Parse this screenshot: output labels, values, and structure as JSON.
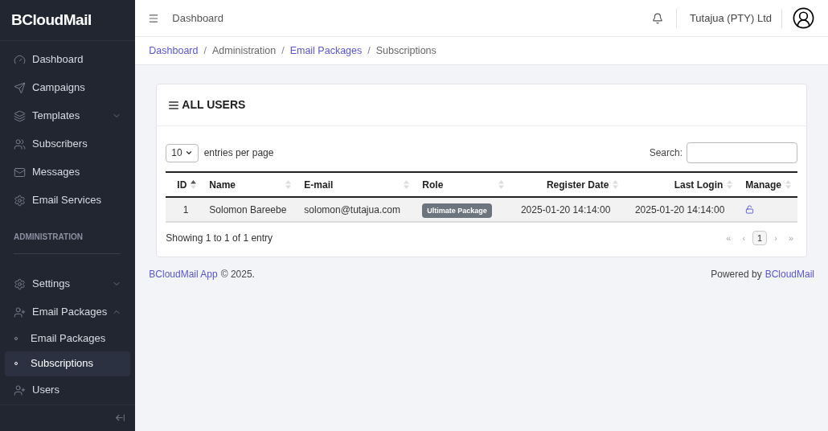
{
  "sidebar": {
    "logo": "BCloudMail",
    "items": [
      {
        "label": "Dashboard"
      },
      {
        "label": "Campaigns"
      },
      {
        "label": "Templates",
        "expanded": false
      },
      {
        "label": "Subscribers"
      },
      {
        "label": "Messages"
      },
      {
        "label": "Email Services"
      }
    ],
    "section_label": "ADMINISTRATION",
    "admin_items": [
      {
        "label": "Settings",
        "expanded": false
      },
      {
        "label": "Email Packages",
        "expanded": true,
        "children": [
          {
            "label": "Email Packages",
            "selected": false
          },
          {
            "label": "Subscriptions",
            "selected": true
          }
        ]
      },
      {
        "label": "Users"
      }
    ]
  },
  "header": {
    "title": "Dashboard",
    "company": "Tutajua (PTY) Ltd"
  },
  "breadcrumb": [
    {
      "label": "Dashboard",
      "link": true
    },
    {
      "label": "Administration",
      "link": false,
      "separator": "/"
    },
    {
      "label": "Email Packages",
      "link": true,
      "separator": "/"
    },
    {
      "label": "Subscriptions",
      "link": false,
      "separator": "/"
    }
  ],
  "card": {
    "title": "ALL USERS",
    "page_size": "10",
    "page_size_label": "entries per page",
    "search_label": "Search:",
    "columns": [
      {
        "label": "ID",
        "sorted": true
      },
      {
        "label": "Name",
        "sorted": false
      },
      {
        "label": "E-mail",
        "sorted": false
      },
      {
        "label": "Role",
        "sorted": false
      },
      {
        "label": "Register Date",
        "sorted": false
      },
      {
        "label": "Last Login",
        "sorted": false
      },
      {
        "label": "Manage",
        "sorted": false
      }
    ],
    "rows": [
      {
        "id": "1",
        "name": "Solomon Bareebe",
        "email": "solomon@tutajua.com",
        "role": "Ultimate Package",
        "register_date": "2025-01-20 14:14:00",
        "last_login": "2025-01-20 14:14:00"
      }
    ],
    "info": "Showing 1 to 1 of 1 entry",
    "pagination": [
      {
        "label": "«",
        "selected": false
      },
      {
        "label": "‹",
        "selected": false
      },
      {
        "label": "1",
        "selected": true
      },
      {
        "label": "›",
        "selected": false
      },
      {
        "label": "»",
        "selected": false
      }
    ]
  },
  "footer": {
    "app": "BCloudMail App",
    "copyright": "© 2025.",
    "powered": "Powered by",
    "brand": "BCloudMail"
  }
}
